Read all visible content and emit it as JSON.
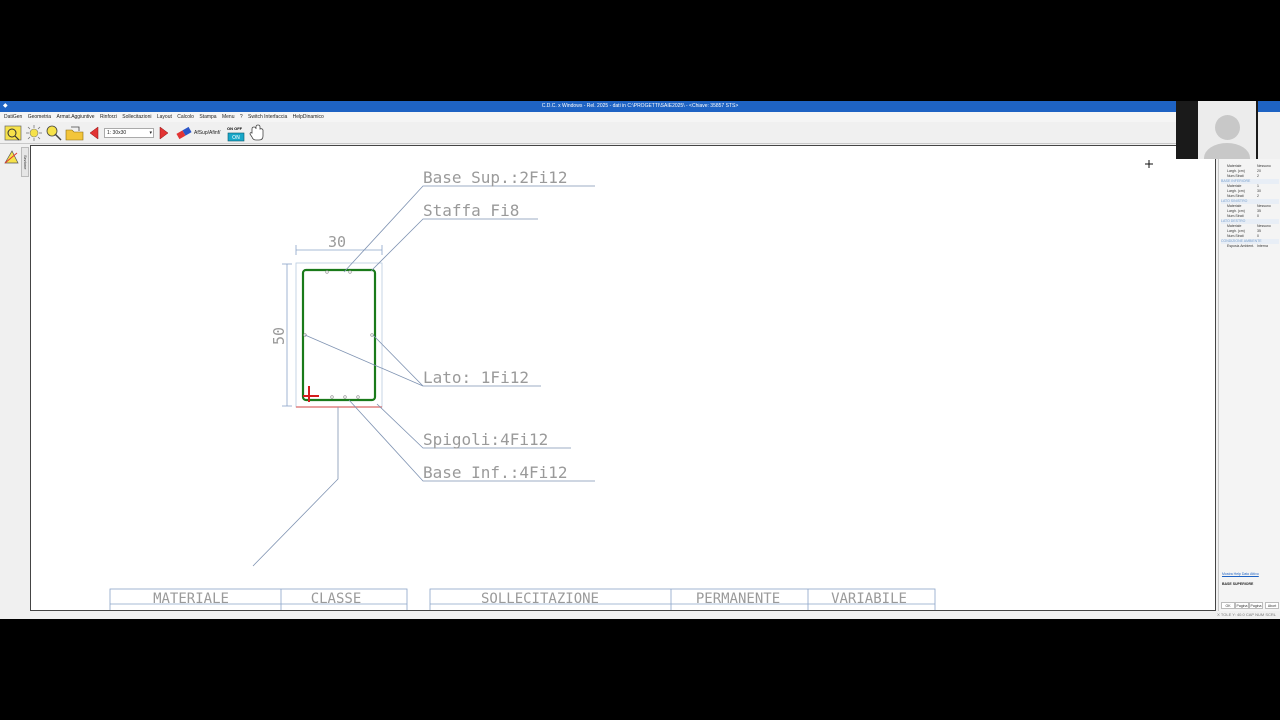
{
  "window": {
    "title": "C.D.C. x Windows - Rel. 2025 - dati in C:\\PROGETTI\\SAIE2025\\ - <Chiave: 35857 STS>"
  },
  "menu": {
    "items": [
      "DatiGen",
      "Geometria",
      "Armat.Aggiuntive",
      "Rinforzi",
      "Sollecitazioni",
      "Layout",
      "Calcolo",
      "Stampa",
      "Menu",
      "?",
      "Switch Interfaccia",
      "HelpDinamico"
    ]
  },
  "toolbar": {
    "scale_value": "1: 30x30",
    "afsup_label": "AfSup/Afinf/",
    "onoff_label": "ON OFF"
  },
  "left_tab": "Sezione",
  "drawing": {
    "dim_width": "30",
    "dim_height": "50",
    "label_base_sup": "Base Sup.:2Fi12",
    "label_staffa": "Staffa Fi8",
    "label_lato": "Lato: 1Fi12",
    "label_spigoli": "Spigoli:4Fi12",
    "label_base_inf": "Base Inf.:4Fi12",
    "table_headers": [
      "MATERIALE",
      "CLASSE",
      "SOLLECITAZIONE",
      "PERMANENTE",
      "VARIABILE"
    ]
  },
  "right_panel": {
    "rows": [
      {
        "type": "row",
        "label": "Materiale",
        "value": "Nessuno"
      },
      {
        "type": "row",
        "label": "Largh. (cm)",
        "value": "20"
      },
      {
        "type": "row",
        "label": "Num.Strati",
        "value": "2"
      },
      {
        "type": "section",
        "label": "BASE INFERIORE"
      },
      {
        "type": "row",
        "label": "Materiale",
        "value": "1"
      },
      {
        "type": "row",
        "label": "Largh. (cm)",
        "value": "30"
      },
      {
        "type": "row",
        "label": "Num.Strati",
        "value": "2"
      },
      {
        "type": "section",
        "label": "LATO SINISTRO"
      },
      {
        "type": "row",
        "label": "Materiale",
        "value": "Nessuno"
      },
      {
        "type": "row",
        "label": "Largh. (cm)",
        "value": "35"
      },
      {
        "type": "row",
        "label": "Num.Strati",
        "value": "0"
      },
      {
        "type": "section",
        "label": "LATO DESTRO"
      },
      {
        "type": "row",
        "label": "Materiale",
        "value": "Nessuno"
      },
      {
        "type": "row",
        "label": "Largh. (cm)",
        "value": "35"
      },
      {
        "type": "row",
        "label": "Num.Strati",
        "value": "0"
      },
      {
        "type": "section",
        "label": "CONDIZIONE AMBIENTE"
      },
      {
        "type": "row",
        "label": "Esposiz.Ambient.",
        "value": "Interna"
      }
    ],
    "link_text": "Mostra Help Dato Attivo",
    "base_label": "BASE SUPERIORE",
    "buttons": [
      "OK",
      "Pagina",
      "Pagina",
      "Abort"
    ]
  },
  "status": {
    "text": "X TOLE Y: 40.0   CAP   NUM   SCRL"
  }
}
